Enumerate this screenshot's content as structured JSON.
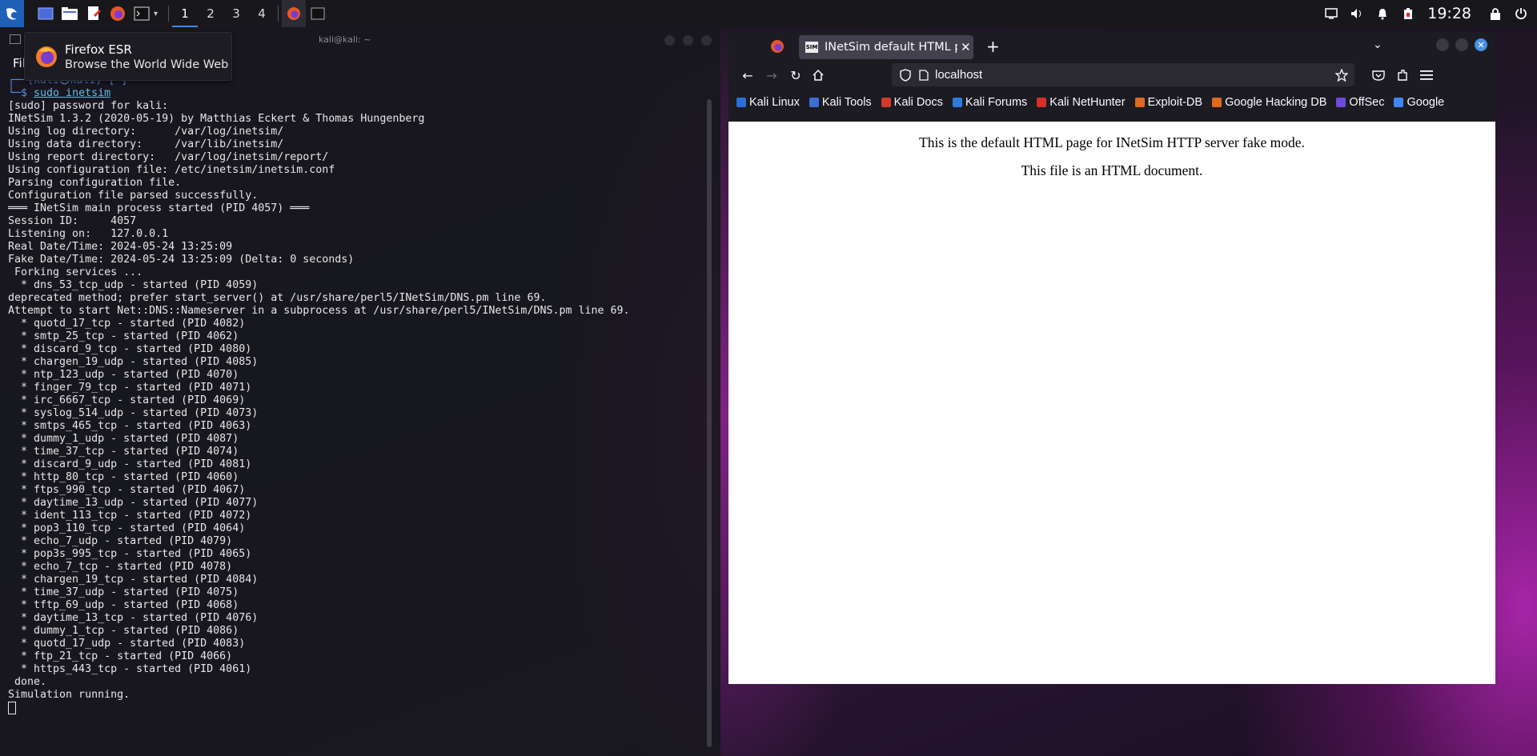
{
  "panel": {
    "workspaces": [
      "1",
      "2",
      "3",
      "4"
    ],
    "active_workspace": "1",
    "clock": "19:28"
  },
  "tooltip": {
    "title": "Firefox ESR",
    "subtitle": "Browse the World Wide Web"
  },
  "terminal": {
    "title": "kali@kali: ~",
    "menu_first": "File",
    "prompt_line": "┌──(kali㉿kali)-[~]",
    "prompt_symbol": "└─$ ",
    "command": "sudo inetsim",
    "output": "[sudo] password for kali:\nINetSim 1.3.2 (2020-05-19) by Matthias Eckert & Thomas Hungenberg\nUsing log directory:      /var/log/inetsim/\nUsing data directory:     /var/lib/inetsim/\nUsing report directory:   /var/log/inetsim/report/\nUsing configuration file: /etc/inetsim/inetsim.conf\nParsing configuration file.\nConfiguration file parsed successfully.\n═══ INetSim main process started (PID 4057) ═══\nSession ID:     4057\nListening on:   127.0.0.1\nReal Date/Time: 2024-05-24 13:25:09\nFake Date/Time: 2024-05-24 13:25:09 (Delta: 0 seconds)\n Forking services ...\n  * dns_53_tcp_udp - started (PID 4059)\ndeprecated method; prefer start_server() at /usr/share/perl5/INetSim/DNS.pm line 69.\nAttempt to start Net::DNS::Nameserver in a subprocess at /usr/share/perl5/INetSim/DNS.pm line 69.\n  * quotd_17_tcp - started (PID 4082)\n  * smtp_25_tcp - started (PID 4062)\n  * discard_9_tcp - started (PID 4080)\n  * chargen_19_udp - started (PID 4085)\n  * ntp_123_udp - started (PID 4070)\n  * finger_79_tcp - started (PID 4071)\n  * irc_6667_tcp - started (PID 4069)\n  * syslog_514_udp - started (PID 4073)\n  * smtps_465_tcp - started (PID 4063)\n  * dummy_1_udp - started (PID 4087)\n  * time_37_tcp - started (PID 4074)\n  * discard_9_udp - started (PID 4081)\n  * http_80_tcp - started (PID 4060)\n  * ftps_990_tcp - started (PID 4067)\n  * daytime_13_udp - started (PID 4077)\n  * ident_113_tcp - started (PID 4072)\n  * pop3_110_tcp - started (PID 4064)\n  * echo_7_udp - started (PID 4079)\n  * pop3s_995_tcp - started (PID 4065)\n  * echo_7_tcp - started (PID 4078)\n  * chargen_19_tcp - started (PID 4084)\n  * time_37_udp - started (PID 4075)\n  * tftp_69_udp - started (PID 4068)\n  * daytime_13_tcp - started (PID 4076)\n  * dummy_1_tcp - started (PID 4086)\n  * quotd_17_udp - started (PID 4083)\n  * ftp_21_tcp - started (PID 4066)\n  * https_443_tcp - started (PID 4061)\n done.\nSimulation running."
  },
  "browser": {
    "tab_title": "INetSim default HTML page",
    "tab_favicon_text": "SIM",
    "url": "localhost",
    "bookmarks": [
      {
        "label": "Kali Linux",
        "color": "#2b6fd6"
      },
      {
        "label": "Kali Tools",
        "color": "#3b6fd6"
      },
      {
        "label": "Kali Docs",
        "color": "#d23a2a"
      },
      {
        "label": "Kali Forums",
        "color": "#2d7be0"
      },
      {
        "label": "Kali NetHunter",
        "color": "#d6302b"
      },
      {
        "label": "Exploit-DB",
        "color": "#e0691f"
      },
      {
        "label": "Google Hacking DB",
        "color": "#e0691f"
      },
      {
        "label": "OffSec",
        "color": "#6d4bd8"
      },
      {
        "label": "Google",
        "color": "#4285f4"
      }
    ],
    "page_line1": "This is the default HTML page for INetSim HTTP server fake mode.",
    "page_line2": "This file is an HTML document."
  }
}
